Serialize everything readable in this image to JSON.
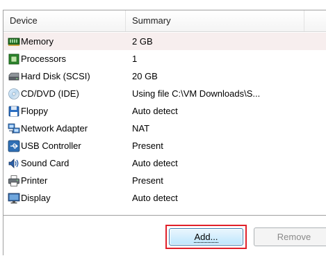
{
  "table": {
    "columns": [
      "Device",
      "Summary"
    ],
    "rows": [
      {
        "device": "Memory",
        "summary": "2 GB",
        "icon": "memory-icon",
        "selected": true
      },
      {
        "device": "Processors",
        "summary": "1",
        "icon": "processor-icon"
      },
      {
        "device": "Hard Disk (SCSI)",
        "summary": "20 GB",
        "icon": "hard-disk-icon"
      },
      {
        "device": "CD/DVD (IDE)",
        "summary": "Using file C:\\VM Downloads\\S...",
        "icon": "cd-dvd-icon"
      },
      {
        "device": "Floppy",
        "summary": "Auto detect",
        "icon": "floppy-icon"
      },
      {
        "device": "Network Adapter",
        "summary": "NAT",
        "icon": "network-adapter-icon"
      },
      {
        "device": "USB Controller",
        "summary": "Present",
        "icon": "usb-icon"
      },
      {
        "device": "Sound Card",
        "summary": "Auto detect",
        "icon": "sound-card-icon"
      },
      {
        "device": "Printer",
        "summary": "Present",
        "icon": "printer-icon"
      },
      {
        "device": "Display",
        "summary": "Auto detect",
        "icon": "display-icon"
      }
    ]
  },
  "buttons": {
    "add_label": "Add...",
    "remove_label": "Remove"
  },
  "colors": {
    "selected_row": "#f7eeee",
    "highlight_box": "#e0202a",
    "add_button_border": "#3c7fb1"
  }
}
